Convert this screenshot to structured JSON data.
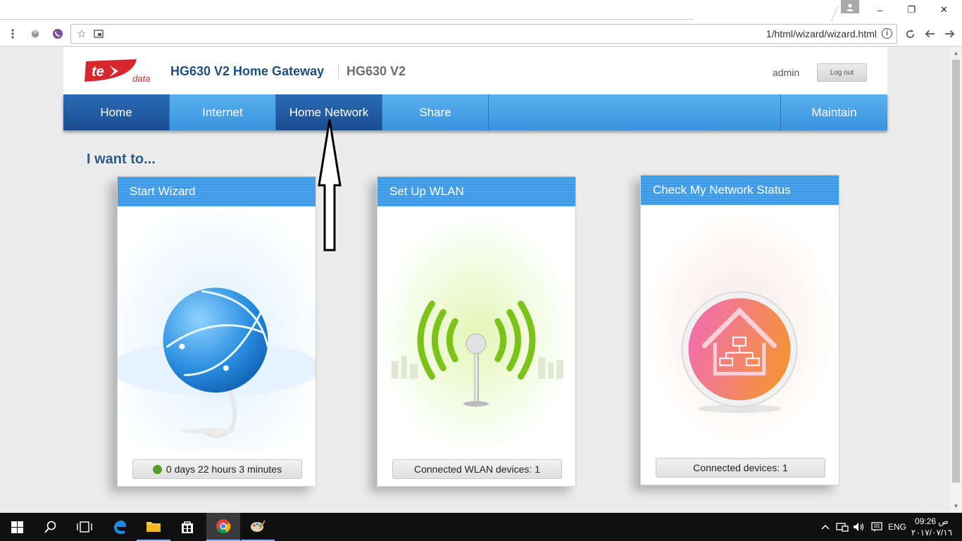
{
  "browser": {
    "url": "1/html/wizard/wizard.html",
    "window_controls": {
      "minimize": "–",
      "restore": "❐",
      "close": "✕"
    }
  },
  "router": {
    "logo_text": "te data",
    "product_name": "HG630 V2 Home Gateway",
    "model": "HG630 V2",
    "username": "admin",
    "logout_label": "Log out",
    "nav": [
      {
        "label": "Home"
      },
      {
        "label": "Internet"
      },
      {
        "label": "Home Network"
      },
      {
        "label": "Share"
      },
      {
        "label": "Maintain"
      }
    ],
    "section_title": "I want to...",
    "cards": [
      {
        "title": "Start Wizard",
        "status": "0 days 22 hours 3 minutes",
        "icon": "globe-icon"
      },
      {
        "title": "Set Up WLAN",
        "status": "Connected WLAN devices: 1",
        "icon": "wifi-antenna-icon"
      },
      {
        "title": "Check My Network Status",
        "status": "Connected devices: 1",
        "icon": "home-network-icon"
      }
    ]
  },
  "taskbar": {
    "language": "ENG",
    "time": "09:26 ص",
    "date": "٢٠١٧/٠٧/١٦"
  },
  "colors": {
    "nav_blue": "#3a93dd",
    "nav_active": "#1a4d90",
    "title_blue": "#1d4f82",
    "logo_red": "#d7262e"
  }
}
